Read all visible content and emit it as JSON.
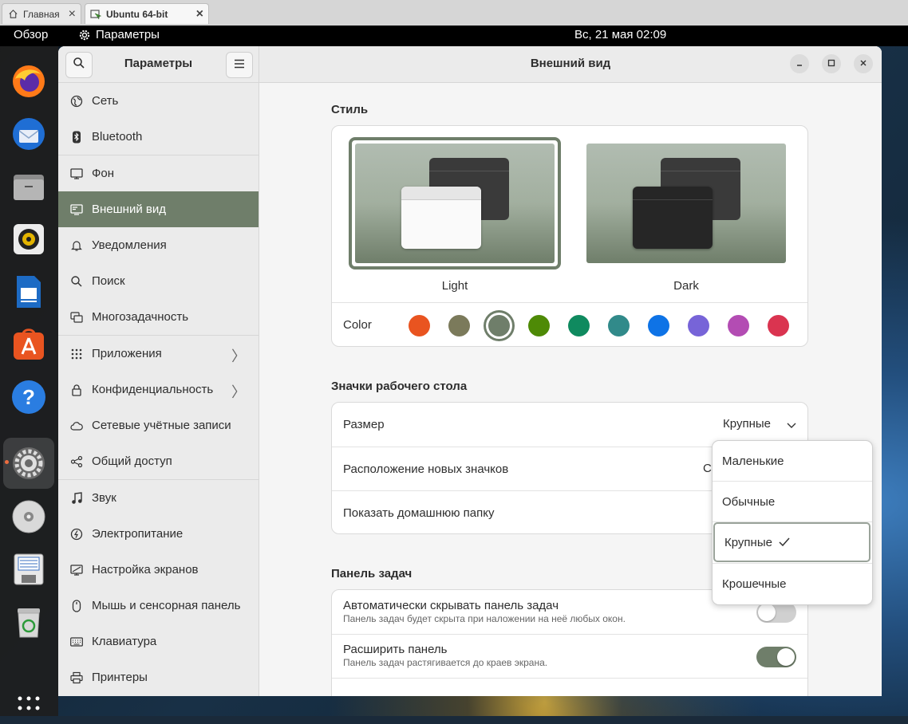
{
  "vm_tabs": [
    {
      "label": "Главная",
      "icon": "home-icon"
    },
    {
      "label": "Ubuntu 64-bit",
      "icon": "vm-icon"
    }
  ],
  "topbar": {
    "overview": "Обзор",
    "app_name": "Параметры",
    "clock": "Вс, 21 мая  02:09"
  },
  "dock": {
    "apps": [
      "firefox-icon",
      "thunderbird-icon",
      "files-icon",
      "rhythmbox-icon",
      "libreoffice-writer-icon",
      "app-center-icon",
      "help-icon",
      "settings-icon",
      "dvd-icon",
      "floppy-icon",
      "trash-icon",
      "show-apps-icon"
    ],
    "active": "settings-icon"
  },
  "sidebar": {
    "title": "Параметры",
    "items": [
      {
        "label": "Сеть",
        "icon": "network-icon"
      },
      {
        "label": "Bluetooth",
        "icon": "bluetooth-icon"
      },
      {
        "label": "Фон",
        "icon": "background-icon"
      },
      {
        "label": "Внешний вид",
        "icon": "appearance-icon",
        "selected": true
      },
      {
        "label": "Уведомления",
        "icon": "bell-icon"
      },
      {
        "label": "Поиск",
        "icon": "search-icon"
      },
      {
        "label": "Многозадачность",
        "icon": "multitasking-icon"
      },
      {
        "label": "Приложения",
        "icon": "apps-grid-icon",
        "arrow": true
      },
      {
        "label": "Конфиденциальность",
        "icon": "lock-icon",
        "arrow": true
      },
      {
        "label": "Сетевые учётные записи",
        "icon": "cloud-icon"
      },
      {
        "label": "Общий доступ",
        "icon": "share-icon"
      },
      {
        "label": "Звук",
        "icon": "music-note-icon"
      },
      {
        "label": "Электропитание",
        "icon": "power-icon"
      },
      {
        "label": "Настройка экранов",
        "icon": "display-icon"
      },
      {
        "label": "Мышь и сенсорная панель",
        "icon": "mouse-icon"
      },
      {
        "label": "Клавиатура",
        "icon": "keyboard-icon"
      },
      {
        "label": "Принтеры",
        "icon": "printer-icon"
      }
    ]
  },
  "content": {
    "title": "Внешний вид",
    "style": {
      "section_title": "Стиль",
      "options": [
        {
          "label": "Light",
          "selected": true
        },
        {
          "label": "Dark",
          "selected": false
        }
      ],
      "color_label": "Color",
      "colors": [
        "#e95420",
        "#7b7a5b",
        "#6f7e6a",
        "#4e8a06",
        "#0f8a5f",
        "#318a8a",
        "#0e73e6",
        "#7764d8",
        "#b34cb3",
        "#da3450"
      ],
      "selected_color": "#6f7e6a"
    },
    "desktop_icons": {
      "section_title": "Значки рабочего стола",
      "size_label": "Размер",
      "size_value": "Крупные",
      "new_icons_label": "Расположение новых значков",
      "new_icons_value_partial": "С",
      "show_home_label": "Показать домашнюю папку"
    },
    "dock_section": {
      "section_title": "Панель задач",
      "autohide_label": "Автоматически скрывать панель задач",
      "autohide_sub": "Панель задач будет скрыта при наложении на неё любых окон.",
      "autohide": false,
      "extend_label": "Расширить панель",
      "extend_sub": "Панель задач растягивается до краев экрана.",
      "extend": true
    }
  },
  "size_popover": {
    "options": [
      "Маленькие",
      "Обычные",
      "Крупные",
      "Крошечные"
    ],
    "selected": "Крупные"
  }
}
